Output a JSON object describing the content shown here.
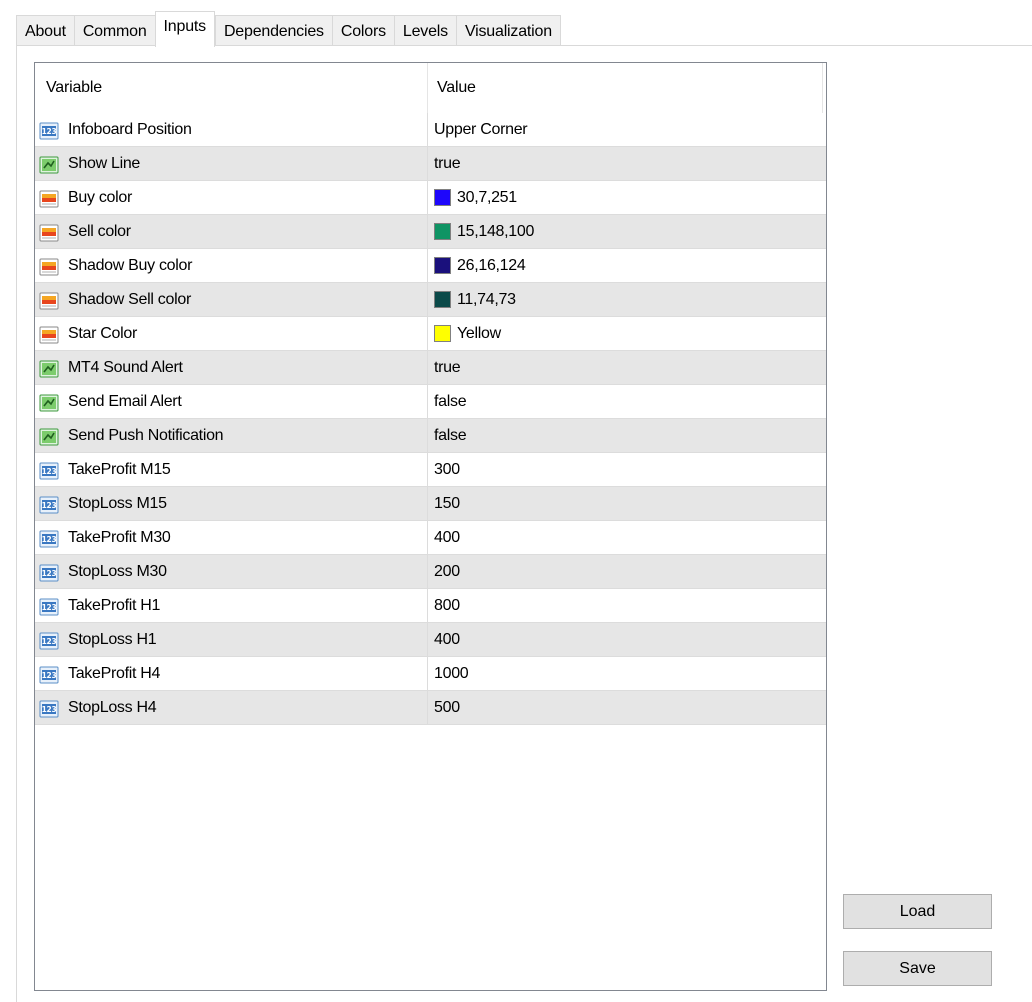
{
  "tabs": [
    {
      "label": "About",
      "active": false
    },
    {
      "label": "Common",
      "active": false
    },
    {
      "label": "Inputs",
      "active": true
    },
    {
      "label": "Dependencies",
      "active": false
    },
    {
      "label": "Colors",
      "active": false
    },
    {
      "label": "Levels",
      "active": false
    },
    {
      "label": "Visualization",
      "active": false
    }
  ],
  "list": {
    "headers": {
      "variable": "Variable",
      "value": "Value"
    },
    "rows": [
      {
        "type": "int",
        "icon": "numeric-icon",
        "name": "Infoboard Position",
        "value": "Upper Corner"
      },
      {
        "type": "bool",
        "icon": "boolean-icon",
        "name": "Show Line",
        "value": "true"
      },
      {
        "type": "color",
        "icon": "color-icon",
        "name": "Buy color",
        "value": "30,7,251",
        "swatch": "#1e07fb"
      },
      {
        "type": "color",
        "icon": "color-icon",
        "name": "Sell color",
        "value": "15,148,100",
        "swatch": "#0f9464"
      },
      {
        "type": "color",
        "icon": "color-icon",
        "name": "Shadow Buy color",
        "value": "26,16,124",
        "swatch": "#1a107c"
      },
      {
        "type": "color",
        "icon": "color-icon",
        "name": "Shadow Sell color",
        "value": "11,74,73",
        "swatch": "#0b4a49"
      },
      {
        "type": "color",
        "icon": "color-icon",
        "name": "Star Color",
        "value": "Yellow",
        "swatch": "#ffff00"
      },
      {
        "type": "bool",
        "icon": "boolean-icon",
        "name": "MT4 Sound Alert",
        "value": "true"
      },
      {
        "type": "bool",
        "icon": "boolean-icon",
        "name": "Send Email Alert",
        "value": "false"
      },
      {
        "type": "bool",
        "icon": "boolean-icon",
        "name": "Send Push Notification",
        "value": "false"
      },
      {
        "type": "int",
        "icon": "numeric-icon",
        "name": "TakeProfit M15",
        "value": "300"
      },
      {
        "type": "int",
        "icon": "numeric-icon",
        "name": "StopLoss M15",
        "value": "150"
      },
      {
        "type": "int",
        "icon": "numeric-icon",
        "name": "TakeProfit M30",
        "value": "400"
      },
      {
        "type": "int",
        "icon": "numeric-icon",
        "name": "StopLoss M30",
        "value": "200"
      },
      {
        "type": "int",
        "icon": "numeric-icon",
        "name": "TakeProfit H1",
        "value": "800"
      },
      {
        "type": "int",
        "icon": "numeric-icon",
        "name": "StopLoss H1",
        "value": "400"
      },
      {
        "type": "int",
        "icon": "numeric-icon",
        "name": "TakeProfit H4",
        "value": "1000"
      },
      {
        "type": "int",
        "icon": "numeric-icon",
        "name": "StopLoss H4",
        "value": "500"
      }
    ]
  },
  "buttons": {
    "load": "Load",
    "save": "Save"
  }
}
